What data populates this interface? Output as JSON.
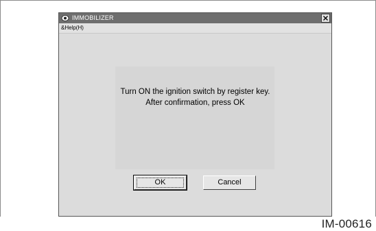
{
  "window": {
    "title": "IMMOBILIZER",
    "close_symbol": "✕"
  },
  "menu": {
    "items": [
      "&Help(H)"
    ]
  },
  "dialog": {
    "message_line1": "Turn ON the ignition switch by register key.",
    "message_line2": "After confirmation, press OK",
    "ok_label": "OK",
    "cancel_label": "Cancel"
  },
  "figure": {
    "id": "IM-00616"
  },
  "icons": {
    "title": "app-eye-icon",
    "close": "close-icon"
  },
  "colors": {
    "titlebar": "#6e6e6e",
    "window_bg": "#dcdcdc"
  }
}
